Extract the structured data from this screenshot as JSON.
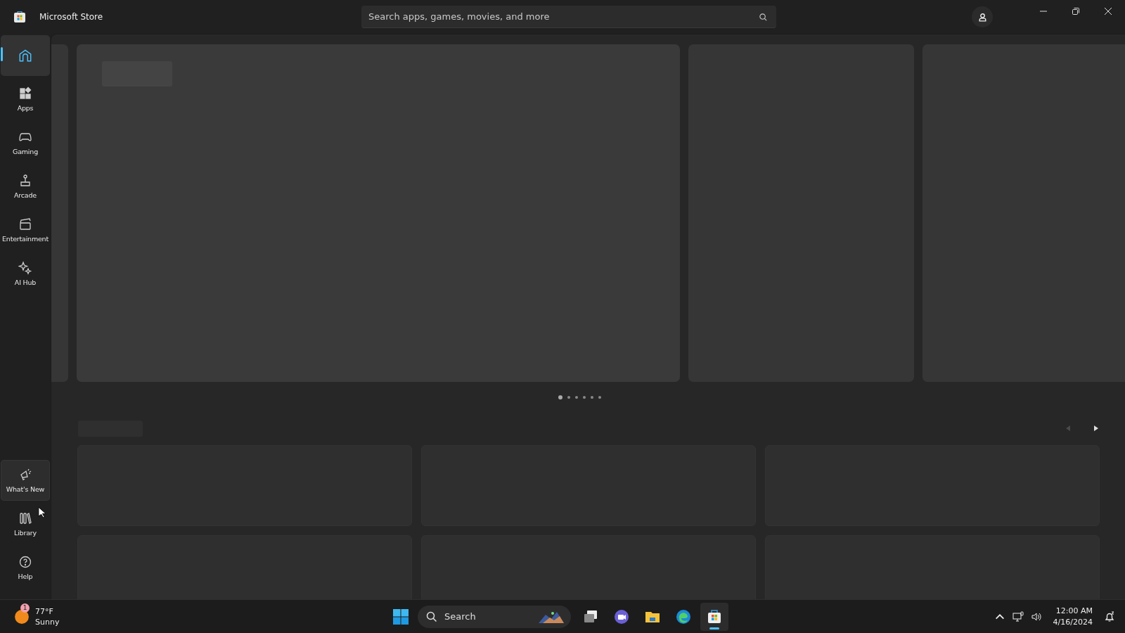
{
  "window": {
    "title": "Microsoft Store"
  },
  "search": {
    "placeholder": "Search apps, games, movies, and more"
  },
  "sidebar": {
    "items": [
      {
        "kind": "home",
        "selected": true,
        "hovered": false
      },
      {
        "kind": "apps",
        "label": "Apps",
        "selected": false,
        "hovered": false
      },
      {
        "kind": "gaming",
        "label": "Gaming",
        "selected": false,
        "hovered": false
      },
      {
        "kind": "arcade",
        "label": "Arcade",
        "selected": false,
        "hovered": false
      },
      {
        "kind": "entertainment",
        "label": "Entertainment",
        "selected": false,
        "hovered": false
      },
      {
        "kind": "aihub",
        "label": "AI Hub",
        "selected": false,
        "hovered": false
      }
    ],
    "bottom_items": [
      {
        "kind": "whatsnew",
        "label": "What's New",
        "selected": false,
        "hovered": true
      },
      {
        "kind": "library",
        "label": "Library",
        "selected": false,
        "hovered": false
      },
      {
        "kind": "help",
        "label": "Help",
        "selected": false,
        "hovered": false
      }
    ]
  },
  "carousel": {
    "dots": [
      {
        "selected": true
      },
      {
        "selected": false
      },
      {
        "selected": false
      },
      {
        "selected": false
      },
      {
        "selected": false
      },
      {
        "selected": false
      }
    ]
  },
  "row_nav": {
    "previous": {
      "disabled": true
    },
    "next": {
      "disabled": false
    }
  },
  "taskbar": {
    "weather": {
      "badge": "1",
      "temperature": "77°F",
      "condition": "Sunny"
    },
    "search": {
      "label": "Search"
    },
    "apps": [
      {
        "kind": "start",
        "active": false
      },
      {
        "kind": "taskview",
        "active": false
      },
      {
        "kind": "meet",
        "active": false
      },
      {
        "kind": "explorer",
        "active": false
      },
      {
        "kind": "edge",
        "active": false
      },
      {
        "kind": "store",
        "active": true
      }
    ],
    "clock": {
      "time": "12:00 AM",
      "date": "4/16/2024"
    }
  }
}
